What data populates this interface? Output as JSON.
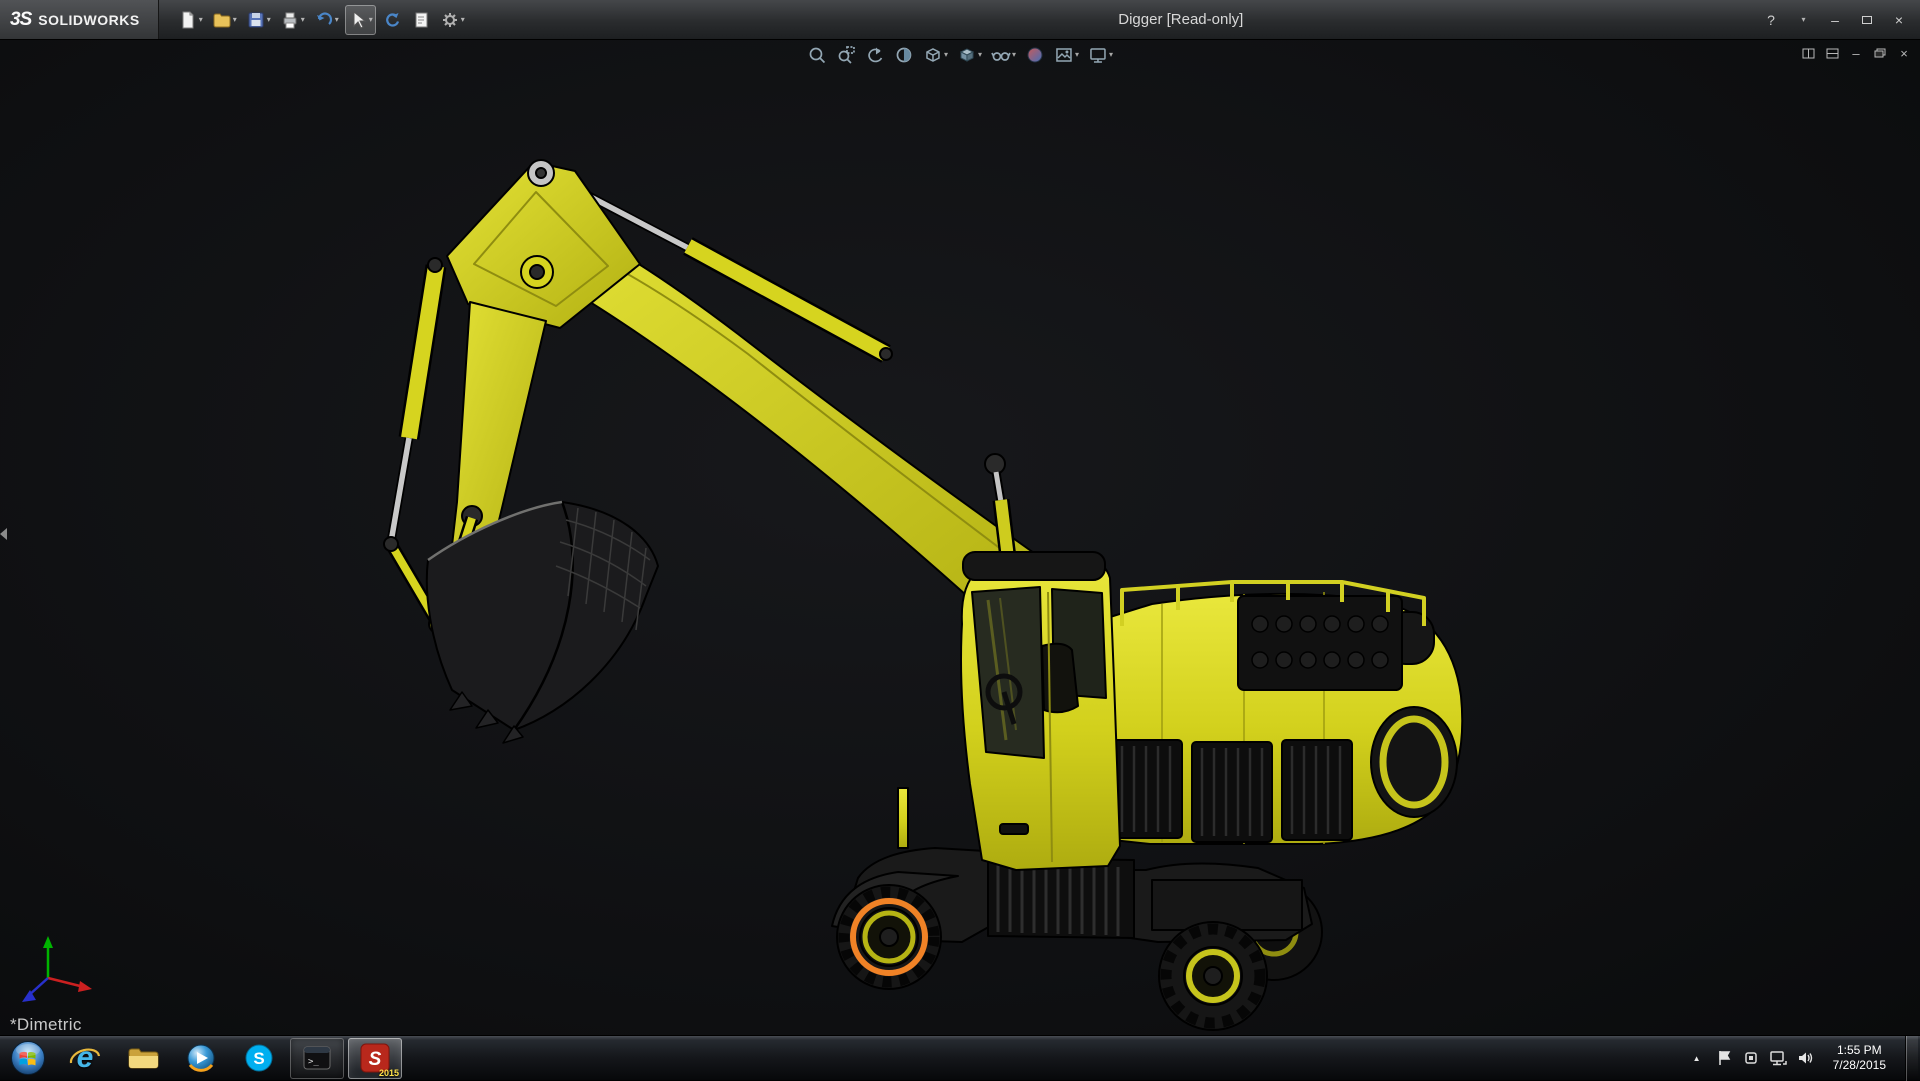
{
  "titlebar": {
    "brand_mark": "3S",
    "brand_name": "SOLIDWORKS",
    "title": "Digger [Read-only]"
  },
  "glyphs": {
    "caret": "▾",
    "minimize": "–",
    "close": "×",
    "help": "?",
    "tray_chevron": "▲",
    "ie_letter": "e",
    "skype_letter": "S",
    "solidworks_letter": "S",
    "cmd_prompt": ">_"
  },
  "main_toolbar": {
    "icons": [
      "new-document",
      "open",
      "save",
      "print",
      "undo",
      "select",
      "rebuild",
      "file-properties",
      "options"
    ],
    "active_tool": "select"
  },
  "heads_up_toolbar": {
    "icons": [
      "zoom-to-fit",
      "zoom-to-area",
      "previous-view",
      "section-view",
      "view-orientation",
      "display-style",
      "hide-show-items",
      "edit-appearance",
      "apply-scene",
      "view-settings"
    ]
  },
  "document_window_controls": [
    "split-view",
    "pane-view",
    "minimize",
    "restore",
    "close"
  ],
  "viewport": {
    "orientation_label": "*Dimetric",
    "model": "Digger wheeled excavator",
    "model_color": "#d2d01c",
    "selection_color": "#f08226",
    "background_color": "#101113"
  },
  "taskbar": {
    "items": [
      "start",
      "internet-explorer",
      "windows-explorer",
      "windows-media-player",
      "skype",
      "command-prompt",
      "solidworks"
    ],
    "active_item": "solidworks",
    "solidworks_badge": "2015",
    "tray_icons": [
      "hidden-icons",
      "action-center-flag",
      "device",
      "network",
      "volume"
    ],
    "clock": {
      "time": "1:55 PM",
      "date": "7/28/2015"
    }
  }
}
